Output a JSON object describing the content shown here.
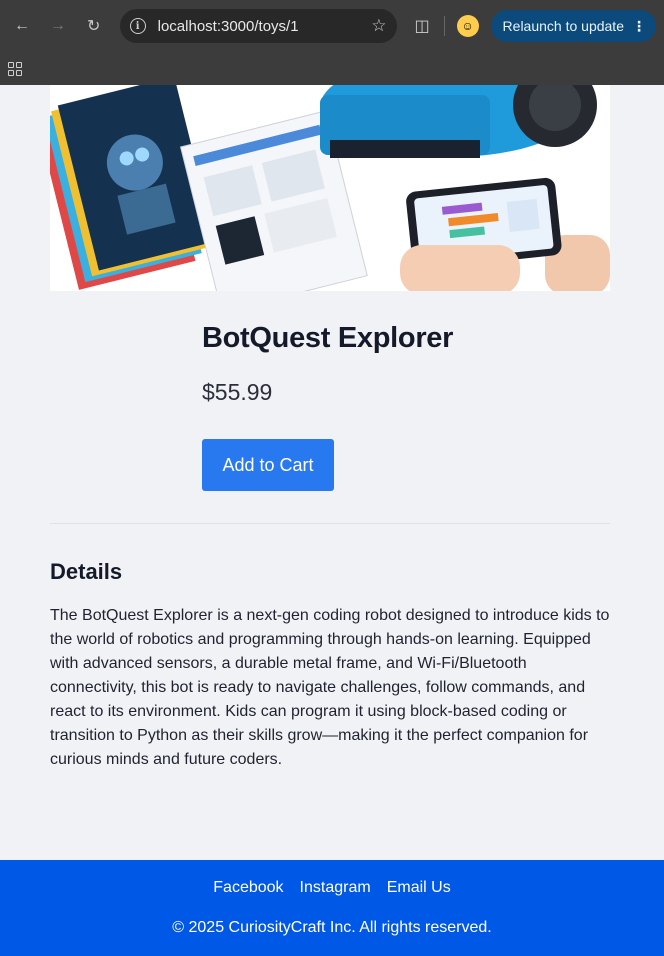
{
  "browser": {
    "url": "localhost:3000/toys/1",
    "relaunch_label": "Relaunch to update"
  },
  "product": {
    "name": "BotQuest Explorer",
    "price": "$55.99",
    "add_to_cart_label": "Add to Cart"
  },
  "details": {
    "heading": "Details",
    "description": "The BotQuest Explorer is a next-gen coding robot designed to introduce kids to the world of robotics and programming through hands-on learning. Equipped with advanced sensors, a durable metal frame, and Wi-Fi/Bluetooth connectivity, this bot is ready to navigate challenges, follow commands, and react to its environment. Kids can program it using block-based coding or transition to Python as their skills grow—making it the perfect companion for curious minds and future coders."
  },
  "footer": {
    "links": [
      "Facebook",
      "Instagram",
      "Email Us"
    ],
    "copyright": "© 2025 CuriosityCraft Inc. All rights reserved."
  },
  "colors": {
    "accent_button": "#2878f0",
    "footer_bg": "#0058e6",
    "page_bg": "#f1f2f5"
  }
}
